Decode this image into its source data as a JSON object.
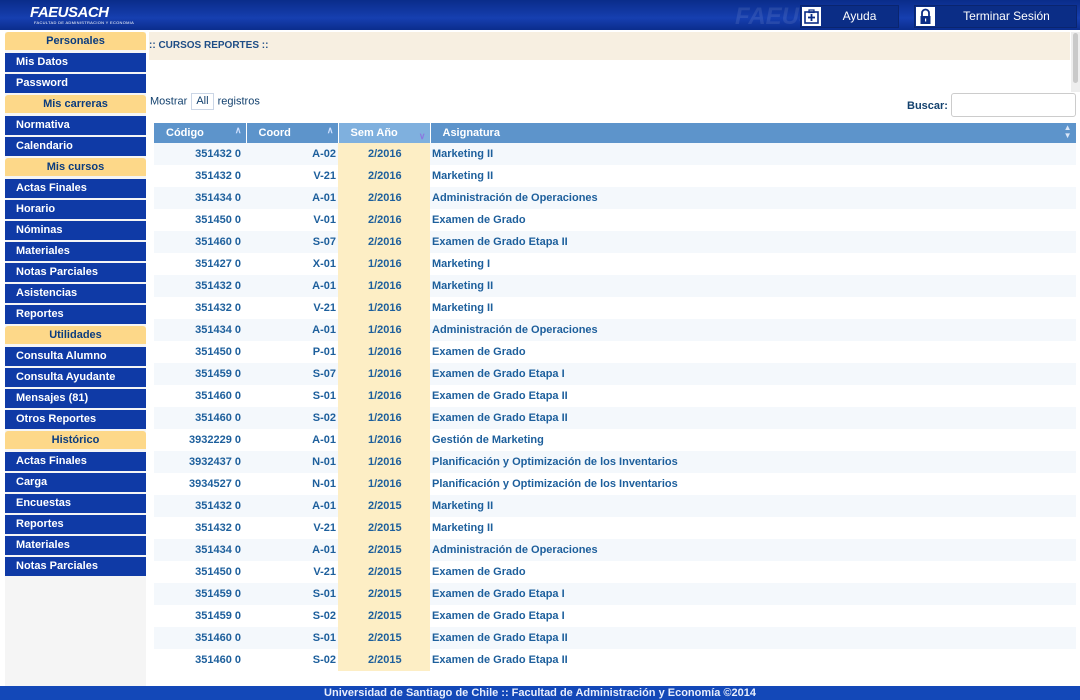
{
  "header": {
    "logo": "FAEUSACH",
    "logo_sub": "FACULTAD DE ADMINISTRACION Y ECONOMIA",
    "watermark": "FAEUSACH",
    "help_label": "Ayuda",
    "logout_label": "Terminar Sesión",
    "help_icon": "first-aid-plus-icon",
    "logout_icon": "lock-icon"
  },
  "sidebar": {
    "sections": [
      {
        "title": "Personales",
        "items": [
          "Mis Datos",
          "Password"
        ]
      },
      {
        "title": "Mis carreras",
        "items": [
          "Normativa",
          "Calendario"
        ]
      },
      {
        "title": "Mis cursos",
        "items": [
          "Actas Finales",
          "Horario",
          "Nóminas",
          "Materiales",
          "Notas Parciales",
          "Asistencias",
          "Reportes"
        ]
      },
      {
        "title": "Utilidades",
        "items": [
          "Consulta Alumno",
          "Consulta Ayudante",
          "Mensajes (81)",
          "Otros Reportes"
        ]
      },
      {
        "title": "Histórico",
        "items": [
          "Actas Finales",
          "Carga",
          "Encuestas",
          "Reportes",
          "Materiales",
          "Notas Parciales"
        ]
      }
    ]
  },
  "main": {
    "title": ":: CURSOS REPORTES ::",
    "show_label": "Mostrar",
    "show_value": "All",
    "records_label": "registros",
    "search_label": "Buscar:",
    "search_value": "",
    "columns": [
      "Código",
      "Coord",
      "Sem Año",
      "Asignatura"
    ],
    "rows": [
      [
        "351432 0",
        "A-02",
        "2/2016",
        "Marketing II"
      ],
      [
        "351432 0",
        "V-21",
        "2/2016",
        "Marketing II"
      ],
      [
        "351434 0",
        "A-01",
        "2/2016",
        "Administración de Operaciones"
      ],
      [
        "351450 0",
        "V-01",
        "2/2016",
        "Examen de Grado"
      ],
      [
        "351460 0",
        "S-07",
        "2/2016",
        "Examen de Grado Etapa II"
      ],
      [
        "351427 0",
        "X-01",
        "1/2016",
        "Marketing I"
      ],
      [
        "351432 0",
        "A-01",
        "1/2016",
        "Marketing II"
      ],
      [
        "351432 0",
        "V-21",
        "1/2016",
        "Marketing II"
      ],
      [
        "351434 0",
        "A-01",
        "1/2016",
        "Administración de Operaciones"
      ],
      [
        "351450 0",
        "P-01",
        "1/2016",
        "Examen de Grado"
      ],
      [
        "351459 0",
        "S-07",
        "1/2016",
        "Examen de Grado Etapa I"
      ],
      [
        "351460 0",
        "S-01",
        "1/2016",
        "Examen de Grado Etapa II"
      ],
      [
        "351460 0",
        "S-02",
        "1/2016",
        "Examen de Grado Etapa II"
      ],
      [
        "3932229 0",
        "A-01",
        "1/2016",
        "Gestión de Marketing"
      ],
      [
        "3932437 0",
        "N-01",
        "1/2016",
        "Planificación y Optimización de los Inventarios"
      ],
      [
        "3934527 0",
        "N-01",
        "1/2016",
        "Planificación y Optimización de los Inventarios"
      ],
      [
        "351432 0",
        "A-01",
        "2/2015",
        "Marketing II"
      ],
      [
        "351432 0",
        "V-21",
        "2/2015",
        "Marketing II"
      ],
      [
        "351434 0",
        "A-01",
        "2/2015",
        "Administración de Operaciones"
      ],
      [
        "351450 0",
        "V-21",
        "2/2015",
        "Examen de Grado"
      ],
      [
        "351459 0",
        "S-01",
        "2/2015",
        "Examen de Grado Etapa I"
      ],
      [
        "351459 0",
        "S-02",
        "2/2015",
        "Examen de Grado Etapa I"
      ],
      [
        "351460 0",
        "S-01",
        "2/2015",
        "Examen de Grado Etapa II"
      ],
      [
        "351460 0",
        "S-02",
        "2/2015",
        "Examen de Grado Etapa II"
      ]
    ]
  },
  "footer": {
    "text": "Universidad de Santiago de Chile :: Facultad de Administración y Economía ©2014"
  },
  "colors": {
    "header_bg": "#163fb0",
    "sidebar_item_bg": "#0f3aa6",
    "section_bg": "#fdd889",
    "table_header_bg": "#5d94cb",
    "sorted_column_bg": "#fdeec5",
    "footer_bg": "#1348b8"
  }
}
